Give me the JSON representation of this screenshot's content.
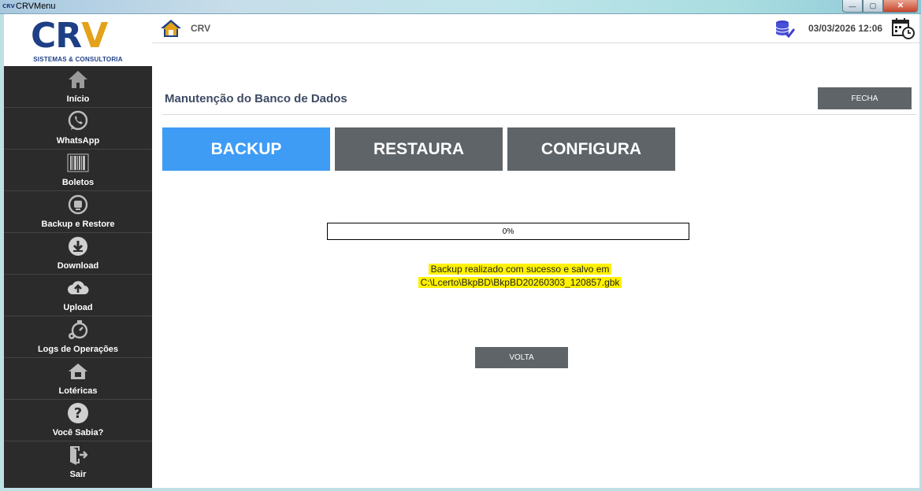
{
  "window": {
    "title": "CRVMenu",
    "app_icon": "CRV",
    "min": "—",
    "max": "▢",
    "close": "✕"
  },
  "logo": {
    "letters": [
      "C",
      "R",
      "V"
    ],
    "subtitle": "SISTEMAS & CONSULTORIA"
  },
  "sidebar": {
    "items": [
      {
        "label": "Início",
        "icon": "home-icon"
      },
      {
        "label": "WhatsApp",
        "icon": "whatsapp-icon"
      },
      {
        "label": "Boletos",
        "icon": "barcode-icon"
      },
      {
        "label": "Backup e Restore",
        "icon": "backup-restore-icon"
      },
      {
        "label": "Download",
        "icon": "download-icon"
      },
      {
        "label": "Upload",
        "icon": "upload-icon"
      },
      {
        "label": "Logs de Operações",
        "icon": "logs-icon"
      },
      {
        "label": "Lotéricas",
        "icon": "store-icon"
      },
      {
        "label": "Você Sabia?",
        "icon": "question-icon"
      },
      {
        "label": "Sair",
        "icon": "exit-icon"
      }
    ]
  },
  "header": {
    "app_label": "CRV",
    "datetime": "03/03/2026 12:06"
  },
  "page": {
    "title": "Manutenção do Banco de Dados",
    "close_label": "FECHA",
    "tabs": [
      {
        "label": "BACKUP",
        "active": true
      },
      {
        "label": "RESTAURA",
        "active": false
      },
      {
        "label": "CONFIGURA",
        "active": false
      }
    ],
    "progress": {
      "value": 0,
      "label": "0%"
    },
    "message": {
      "line1": "Backup realizado com sucesso e salvo em",
      "line2": "C:\\Lcerto\\BkpBD\\BkpBD20260303_120857.gbk"
    },
    "back_label": "VOLTA"
  },
  "colors": {
    "accent": "#3e9cf5",
    "button": "#5e6468",
    "sidebar": "#2b2b2b",
    "highlight": "#fff200",
    "logo_blue": "#1e3f85",
    "logo_gold": "#e3a21a"
  }
}
